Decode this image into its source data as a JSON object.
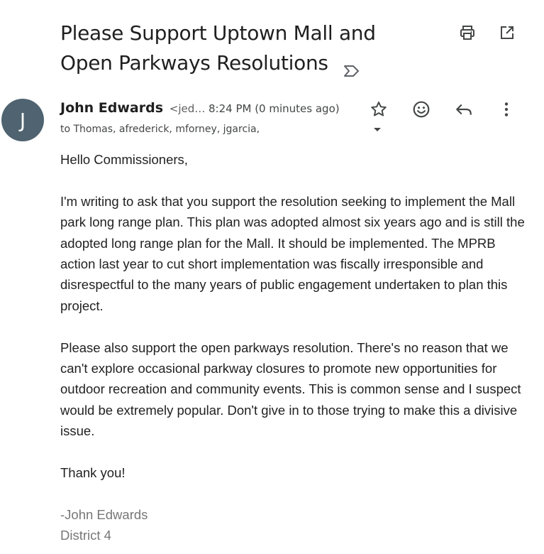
{
  "subject": {
    "text": "Please Support Uptown Mall and Open Parkways Resolutions",
    "label_icon": "label-arrow-icon"
  },
  "toolbar": {
    "icons": [
      "print-icon",
      "open-in-new-window-icon"
    ]
  },
  "message": {
    "avatar_letter": "J",
    "avatar_color": "#4f6370",
    "sender_name": "John Edwards",
    "sender_email": "<jed…",
    "time": "8:24 PM (0 minutes ago)",
    "recipients": "to Thomas, afrederick, mforney, jgarcia,",
    "action_icons": [
      "star-icon",
      "emoji-reaction-icon",
      "reply-icon",
      "more-vert-icon"
    ]
  },
  "body": {
    "greeting": "Hello Commissioners,",
    "paragraph1": "I'm writing to ask that you support the resolution seeking to implement the Mall park long range plan. This plan was adopted almost six years ago and is still the adopted long range plan for the Mall. It should be implemented. The MPRB action last year to cut short implementation was fiscally irresponsible and disrespectful to the many years of public engagement undertaken to plan this project.",
    "paragraph2": "Please also support the open parkways resolution. There's no reason that we can't explore occasional parkway closures to promote new opportunities for outdoor recreation and community events. This is common sense and I suspect would be extremely popular. Don't give in to those trying to make this a divisive issue.",
    "closing": "Thank you!",
    "signature_name": "-John Edwards",
    "signature_district": "District 4"
  }
}
